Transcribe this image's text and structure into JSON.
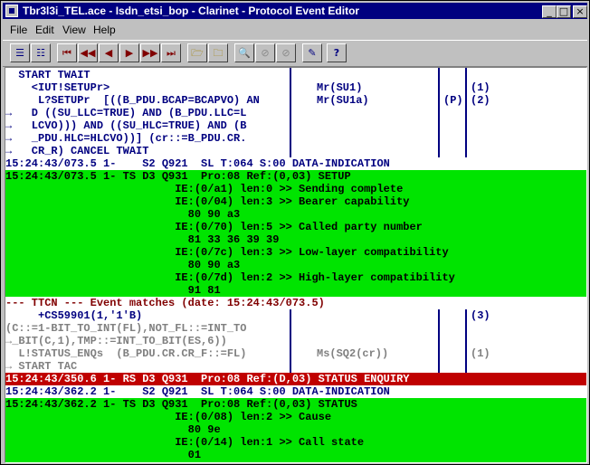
{
  "window": {
    "title": "Tbr3l3i_TEL.ace - Isdn_etsi_bop - Clarinet - Protocol Event Editor",
    "controls": {
      "minimize": "_",
      "maximize": "□",
      "close": "×"
    }
  },
  "menu": [
    "File",
    "Edit",
    "View",
    "Help"
  ],
  "toolbar": {
    "buttons": [
      {
        "name": "view-list-button",
        "icon": "☰"
      },
      {
        "name": "view-tree-button",
        "icon": "☷"
      },
      {
        "name": "first-button",
        "icon": "⏮"
      },
      {
        "name": "previous-page-button",
        "icon": "◀◀"
      },
      {
        "name": "previous-button",
        "icon": "◀"
      },
      {
        "name": "next-button",
        "icon": "▶"
      },
      {
        "name": "next-page-button",
        "icon": "▶▶"
      },
      {
        "name": "last-button",
        "icon": "⏭"
      },
      {
        "name": "open-folder-button",
        "icon": "🗁"
      },
      {
        "name": "save-folder-button",
        "icon": "🗀"
      },
      {
        "name": "find-button",
        "icon": "🔍"
      },
      {
        "name": "find-previous-button",
        "icon": "⊘"
      },
      {
        "name": "find-next-button",
        "icon": "⊘"
      },
      {
        "name": "edit-button",
        "icon": "✎"
      },
      {
        "name": "help-button",
        "icon": "?"
      }
    ]
  },
  "ttcn_block1": {
    "rows": [
      {
        "prefix": " ",
        "text": " START TWAIT",
        "col2": "",
        "col3": "",
        "col4": ""
      },
      {
        "prefix": " ",
        "text": "   <IUT!SETUPr>",
        "col2": "Mr(SU1)",
        "col3": "",
        "col4": "(1)"
      },
      {
        "prefix": " ",
        "text": "    L?SETUPr  [((B_PDU.BCAP=BCAPVO) AN",
        "col2": "Mr(SU1a)",
        "col3": "(P)",
        "col4": "(2)"
      },
      {
        "prefix": "→",
        "text": "   D ((SU_LLC=TRUE) AND (B_PDU.LLC=L",
        "col2": "",
        "col3": "",
        "col4": ""
      },
      {
        "prefix": "→",
        "text": "   LCVO))) AND ((SU_HLC=TRUE) AND (B",
        "col2": "",
        "col3": "",
        "col4": ""
      },
      {
        "prefix": "→",
        "text": "   _PDU.HLC=HLCVO))] (cr::=B_PDU.CR.",
        "col2": "",
        "col3": "",
        "col4": ""
      },
      {
        "prefix": "→",
        "text": "   CR_R) CANCEL TWAIT",
        "col2": "",
        "col3": "",
        "col4": ""
      }
    ]
  },
  "event1": "15:24:43/073.5 1-    S2 Q921  SL T:064 S:00 DATA-INDICATION",
  "msg1": [
    "15:24:43/073.5 1- TS D3 Q931  Pro:08 Ref:(0,03) SETUP",
    "                          IE:(0/a1) len:0 >> Sending complete",
    "                          IE:(0/04) len:3 >> Bearer capability",
    "                            80 90 a3",
    "                          IE:(0/70) len:5 >> Called party number",
    "                            81 33 36 39 39",
    "                          IE:(0/7c) len:3 >> Low-layer compatibility",
    "                            80 90 a3",
    "                          IE:(0/7d) len:2 >> High-layer compatibility",
    "                            91 81"
  ],
  "ttcn_match": "--- TTCN --- Event matches (date: 15:24:43/073.5)",
  "ttcn_block2": {
    "rows": [
      {
        "text": "     +CS59901(1,'1'B)",
        "col2": "",
        "col3": "",
        "col4": "(3)",
        "style": "navy"
      },
      {
        "text": "(C::=1-BIT_TO_INT(FL),NOT_FL::=INT_TO",
        "col2": "",
        "col3": "",
        "col4": "",
        "style": "gray"
      },
      {
        "text": "→_BIT(C,1),TMP::=INT_TO_BIT(ES,6))",
        "col2": "",
        "col3": "",
        "col4": "",
        "style": "gray"
      },
      {
        "text": "  L!STATUS_ENQs  (B_PDU.CR.CR_F::=FL)",
        "col2": "Ms(SQ2(cr))",
        "col3": "",
        "col4": "(1)",
        "style": "gray"
      },
      {
        "text": "→ START TAC",
        "col2": "",
        "col3": "",
        "col4": "",
        "style": "gray"
      }
    ]
  },
  "event_red": "15:24:43/350.6 1- RS D3 Q931  Pro:08 Ref:(D,03) STATUS ENQUIRY",
  "event2": "15:24:43/362.2 1-    S2 Q921  SL T:064 S:00 DATA-INDICATION",
  "msg2": [
    "15:24:43/362.2 1- TS D3 Q931  Pro:08 Ref:(0,03) STATUS",
    "                          IE:(0/08) len:2 >> Cause",
    "                            80 9e",
    "                          IE:(0/14) len:1 >> Call state",
    "                            01"
  ],
  "colors": {
    "green": "#00e400",
    "red": "#c00000",
    "navy": "#000080",
    "maroon": "#800000"
  }
}
